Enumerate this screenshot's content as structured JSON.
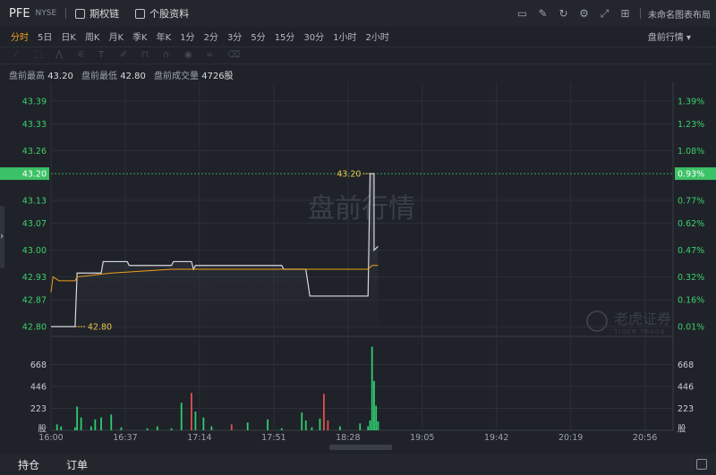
{
  "header": {
    "symbol": "PFE",
    "exchange": "NYSE",
    "links": [
      {
        "label": "期权链",
        "icon": "option-chain-icon"
      },
      {
        "label": "个股资料",
        "icon": "profile-icon"
      }
    ],
    "icons": [
      "screen-icon",
      "edit-icon",
      "refresh-icon",
      "gear-icon",
      "fullscreen-icon",
      "grid-icon"
    ],
    "layout_name": "未命名图表布局"
  },
  "periods": [
    "分时",
    "5日",
    "日K",
    "周K",
    "月K",
    "季K",
    "年K",
    "1分",
    "2分",
    "3分",
    "5分",
    "15分",
    "30分",
    "1小时",
    "2小时"
  ],
  "active_period": "分时",
  "mode_label": "盘前行情 ▾",
  "draw_tools": [
    "line-tool-icon",
    "rect-tool-icon",
    "pattern-tool-icon",
    "fib-tool-icon",
    "text-tool-icon",
    "brush-tool-icon",
    "lock-icon",
    "magnet-icon",
    "eye-icon",
    "link-icon",
    "delete-icon"
  ],
  "info": {
    "high_label": "盘前最高",
    "high": "43.20",
    "low_label": "盘前最低",
    "low": "42.80",
    "vol_label": "盘前成交量",
    "vol": "4726股"
  },
  "watermark": "盘前行情",
  "brand_watermark": {
    "cn": "老虎证券",
    "en": "TIGER TRADE"
  },
  "bottom_tabs": [
    "持仓",
    "订单"
  ],
  "colors": {
    "accent": "#f0a020",
    "up": "#2ecc71",
    "down": "#e05050",
    "price_tag": "#3cc266"
  },
  "chart_data": {
    "type": "line",
    "price_axis": {
      "ticks": [
        43.39,
        43.33,
        43.26,
        43.2,
        43.13,
        43.07,
        43.0,
        42.93,
        42.87,
        42.8
      ],
      "tick_labels": [
        "43.39",
        "43.33",
        "43.26",
        "43.20",
        "43.13",
        "43.07",
        "43.00",
        "42.93",
        "42.87",
        "42.80"
      ],
      "range": [
        42.784,
        43.42
      ]
    },
    "pct_axis": {
      "tick_labels": [
        "1.39%",
        "1.23%",
        "1.08%",
        "0.93%",
        "0.77%",
        "0.62%",
        "0.47%",
        "0.32%",
        "0.16%",
        "0.01%"
      ]
    },
    "time_axis": {
      "ticks": [
        "16:00",
        "16:37",
        "17:14",
        "17:51",
        "18:28",
        "19:05",
        "19:42",
        "20:19",
        "20:56"
      ],
      "start": "16:00",
      "end": "21:10"
    },
    "current_price_tag": "43.20",
    "current_pct_tag": "0.93%",
    "high_annotation": "43.20",
    "low_annotation": "42.80",
    "price_series": [
      {
        "t": "16:00",
        "p": 42.8
      },
      {
        "t": "16:12",
        "p": 42.8
      },
      {
        "t": "16:13",
        "p": 42.94
      },
      {
        "t": "16:25",
        "p": 42.94
      },
      {
        "t": "16:26",
        "p": 42.97
      },
      {
        "t": "16:38",
        "p": 42.97
      },
      {
        "t": "16:39",
        "p": 42.96
      },
      {
        "t": "17:00",
        "p": 42.96
      },
      {
        "t": "17:01",
        "p": 42.97
      },
      {
        "t": "17:10",
        "p": 42.97
      },
      {
        "t": "17:11",
        "p": 42.95
      },
      {
        "t": "17:12",
        "p": 42.96
      },
      {
        "t": "17:55",
        "p": 42.96
      },
      {
        "t": "17:56",
        "p": 42.95
      },
      {
        "t": "18:07",
        "p": 42.95
      },
      {
        "t": "18:09",
        "p": 42.88
      },
      {
        "t": "18:38",
        "p": 42.88
      },
      {
        "t": "18:39",
        "p": 43.2
      },
      {
        "t": "18:41",
        "p": 43.2
      },
      {
        "t": "18:41",
        "p": 43.0
      },
      {
        "t": "18:43",
        "p": 43.01
      }
    ],
    "avg_series": [
      {
        "t": "16:00",
        "p": 42.89
      },
      {
        "t": "16:01",
        "p": 42.93
      },
      {
        "t": "16:04",
        "p": 42.92
      },
      {
        "t": "16:07",
        "p": 42.92
      },
      {
        "t": "16:12",
        "p": 42.92
      },
      {
        "t": "16:13",
        "p": 42.93
      },
      {
        "t": "16:30",
        "p": 42.94
      },
      {
        "t": "17:00",
        "p": 42.95
      },
      {
        "t": "17:30",
        "p": 42.95
      },
      {
        "t": "18:00",
        "p": 42.95
      },
      {
        "t": "18:38",
        "p": 42.95
      },
      {
        "t": "18:40",
        "p": 42.96
      },
      {
        "t": "18:43",
        "p": 42.96
      }
    ],
    "volume_axis": {
      "tick_labels": [
        "668",
        "446",
        "223",
        "股"
      ],
      "ticks": [
        668,
        446,
        223,
        0
      ],
      "max": 900
    },
    "volume_series": [
      {
        "t": "16:03",
        "v": 60,
        "c": "up"
      },
      {
        "t": "16:05",
        "v": 40,
        "c": "up"
      },
      {
        "t": "16:12",
        "v": 30,
        "c": "up"
      },
      {
        "t": "16:13",
        "v": 240,
        "c": "up"
      },
      {
        "t": "16:15",
        "v": 130,
        "c": "up"
      },
      {
        "t": "16:20",
        "v": 40,
        "c": "up"
      },
      {
        "t": "16:22",
        "v": 110,
        "c": "up"
      },
      {
        "t": "16:25",
        "v": 130,
        "c": "up"
      },
      {
        "t": "16:30",
        "v": 160,
        "c": "up"
      },
      {
        "t": "16:35",
        "v": 30,
        "c": "up"
      },
      {
        "t": "16:48",
        "v": 20,
        "c": "up"
      },
      {
        "t": "16:53",
        "v": 40,
        "c": "up"
      },
      {
        "t": "17:00",
        "v": 20,
        "c": "up"
      },
      {
        "t": "17:05",
        "v": 280,
        "c": "up"
      },
      {
        "t": "17:10",
        "v": 380,
        "c": "down"
      },
      {
        "t": "17:12",
        "v": 190,
        "c": "up"
      },
      {
        "t": "17:16",
        "v": 130,
        "c": "up"
      },
      {
        "t": "17:20",
        "v": 40,
        "c": "up"
      },
      {
        "t": "17:30",
        "v": 60,
        "c": "down"
      },
      {
        "t": "17:38",
        "v": 80,
        "c": "up"
      },
      {
        "t": "17:48",
        "v": 110,
        "c": "up"
      },
      {
        "t": "17:55",
        "v": 20,
        "c": "up"
      },
      {
        "t": "18:05",
        "v": 180,
        "c": "up"
      },
      {
        "t": "18:07",
        "v": 100,
        "c": "up"
      },
      {
        "t": "18:10",
        "v": 30,
        "c": "up"
      },
      {
        "t": "18:14",
        "v": 120,
        "c": "up"
      },
      {
        "t": "18:16",
        "v": 370,
        "c": "down"
      },
      {
        "t": "18:18",
        "v": 100,
        "c": "down"
      },
      {
        "t": "18:24",
        "v": 40,
        "c": "up"
      },
      {
        "t": "18:34",
        "v": 70,
        "c": "up"
      },
      {
        "t": "18:38",
        "v": 40,
        "c": "up"
      },
      {
        "t": "18:39",
        "v": 100,
        "c": "up"
      },
      {
        "t": "18:40",
        "v": 850,
        "c": "up"
      },
      {
        "t": "18:41",
        "v": 500,
        "c": "up"
      },
      {
        "t": "18:42",
        "v": 250,
        "c": "up"
      },
      {
        "t": "18:43",
        "v": 90,
        "c": "up"
      }
    ]
  }
}
